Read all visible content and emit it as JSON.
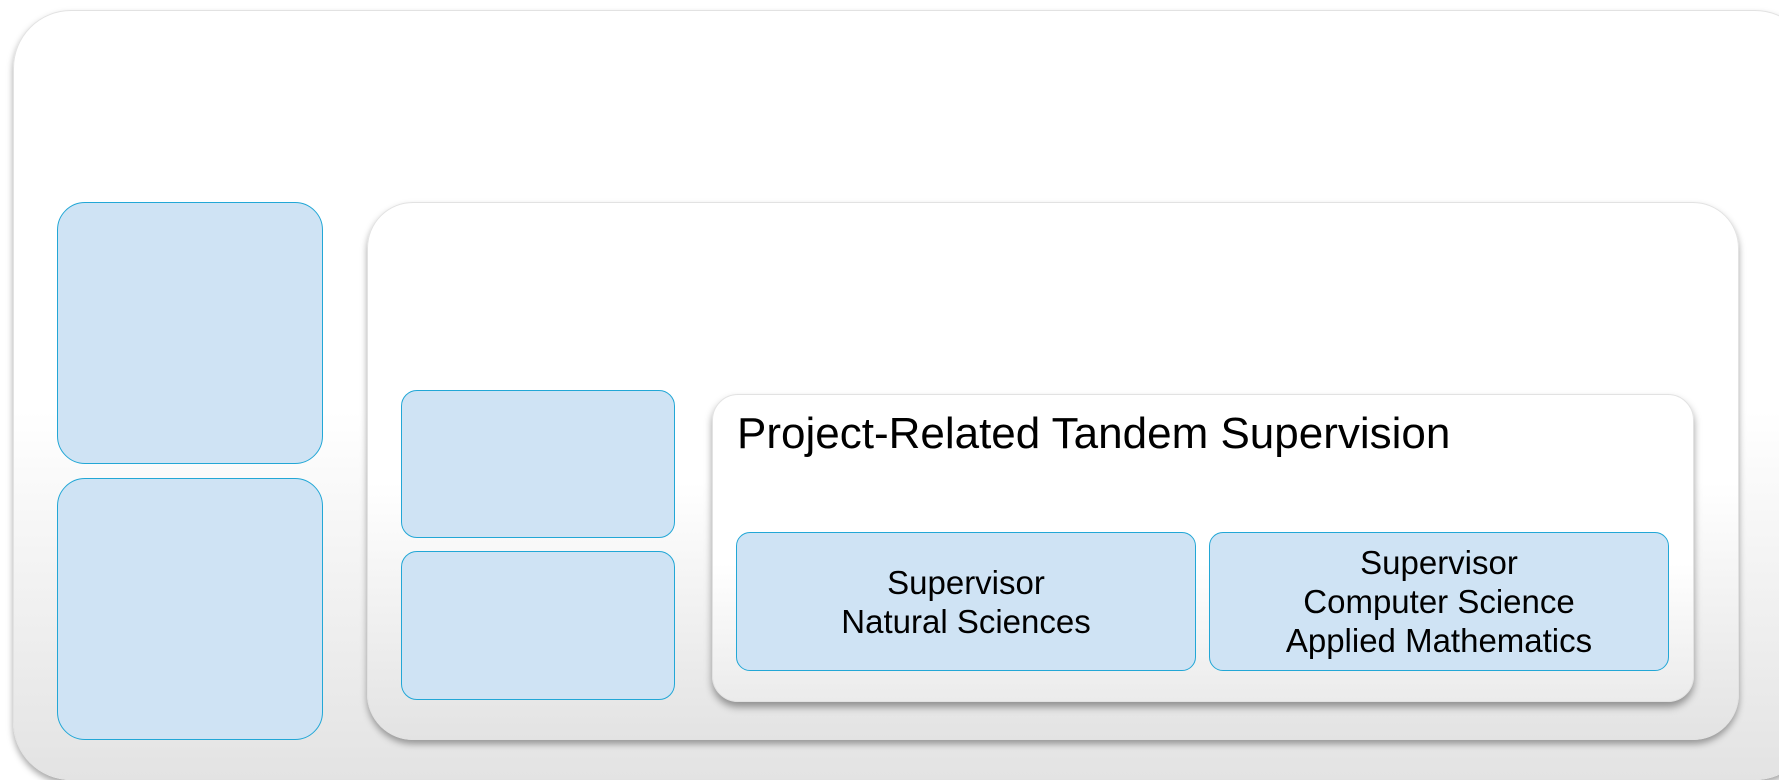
{
  "diagram": {
    "title": "Project-Related Tandem Supervision",
    "supervisors": [
      {
        "lines": [
          "Supervisor",
          "Natural Sciences"
        ]
      },
      {
        "lines": [
          "Supervisor",
          "Computer Science",
          "Applied Mathematics"
        ]
      }
    ],
    "colors": {
      "box_fill": "#cfe3f4",
      "box_border": "#22a7d6",
      "panel_fill": "#ffffff"
    }
  }
}
